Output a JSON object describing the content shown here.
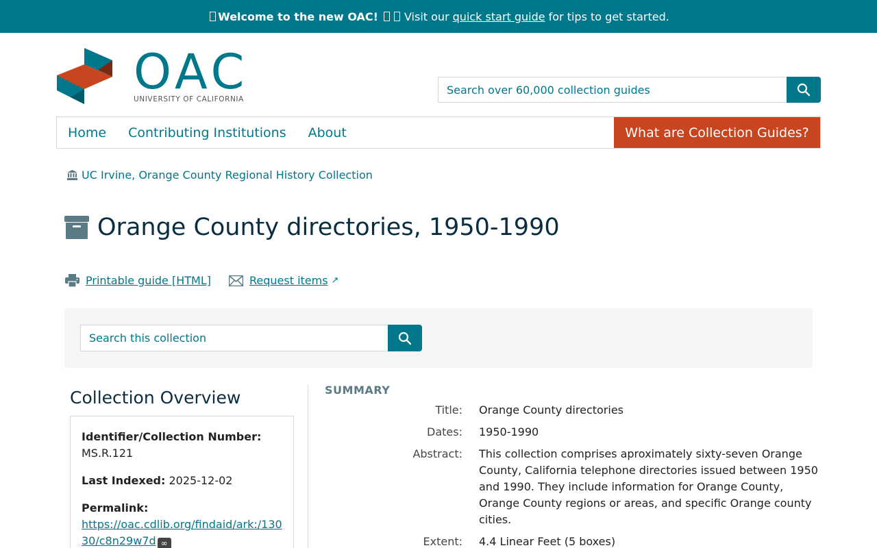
{
  "banner": {
    "bold_text": "Welcome to the new OAC!",
    "pre_link": "Visit our",
    "link_text": "quick start guide",
    "post_link": "for tips to get started."
  },
  "logo": {
    "word": "OAC",
    "subtitle": "UNIVERSITY OF CALIFORNIA",
    "colors": {
      "teal": "#00778b",
      "orange": "#c8451f",
      "dark": "#7a2a14"
    }
  },
  "site_search": {
    "placeholder": "Search over 60,000 collection guides",
    "icon": "search-icon"
  },
  "nav": {
    "items": [
      "Home",
      "Contributing Institutions",
      "About"
    ],
    "cta": "What are Collection Guides?"
  },
  "breadcrumb": {
    "icon": "institution-icon",
    "label": "UC Irvine, Orange County Regional History Collection"
  },
  "page_title": {
    "icon": "archive-box-icon",
    "text": "Orange County directories, 1950-1990"
  },
  "actions": [
    {
      "icon": "printer-icon",
      "label": "Printable guide [HTML]"
    },
    {
      "icon": "envelope-icon",
      "label": "Request items",
      "suffix": "↗"
    }
  ],
  "collection_search": {
    "placeholder": "Search this collection"
  },
  "overview": {
    "title": "Collection Overview",
    "identifier_label": "Identifier/Collection Number:",
    "identifier_value": "MS.R.121",
    "indexed_label": "Last Indexed:",
    "indexed_value": "2025-12-02",
    "permalink_label": "Permalink:",
    "permalink_value": "https://oac.cdlib.org/findaid/ark:/13030/c8n29w7d",
    "permalink_icon": "∞"
  },
  "summary": {
    "heading": "SUMMARY",
    "rows": [
      {
        "label": "Title:",
        "value": "Orange County directories"
      },
      {
        "label": "Dates:",
        "value": "1950-1990"
      },
      {
        "label": "Abstract:",
        "value": "This collection comprises aproximately sixty-seven Orange County, California telephone directories issued between 1950 and 1990. They include information for Orange County, Orange County regions or areas, and specific Orange county cities."
      },
      {
        "label": "Extent:",
        "value": "4.4 Linear Feet (5 boxes)"
      }
    ]
  }
}
